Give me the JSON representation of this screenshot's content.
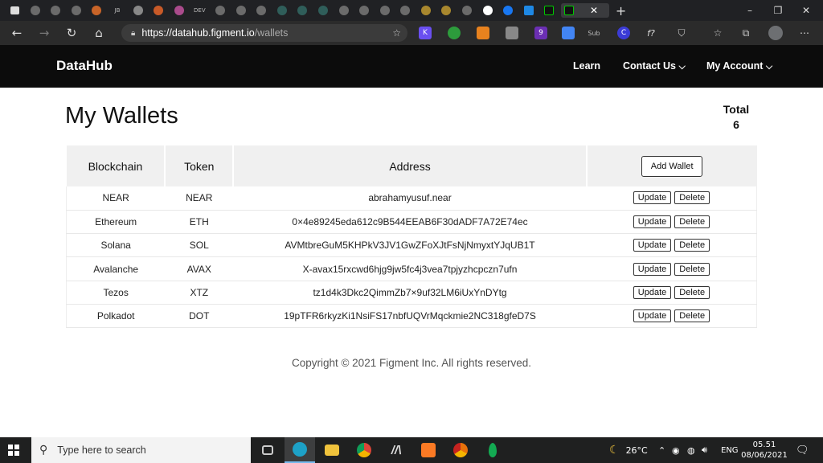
{
  "browser": {
    "url_host": "https://datahub.figment.io",
    "url_path": "/wallets",
    "tab_texts": [
      "JB",
      "DEV"
    ],
    "extensions": [
      {
        "icon": "k-extension-icon",
        "glyph": "K",
        "color": "#6a4ff0"
      },
      {
        "icon": "globe-extension-icon",
        "glyph": "",
        "color": "#2d9c3c"
      },
      {
        "icon": "metamask-icon",
        "glyph": "",
        "color": "#e8821e"
      },
      {
        "icon": "mail-extension-icon",
        "glyph": "",
        "color": "#888888"
      },
      {
        "icon": "purple-extension-icon",
        "glyph": "9",
        "color": "#6b2fb3"
      },
      {
        "icon": "translate-icon",
        "glyph": "",
        "color": "#4285f4"
      },
      {
        "icon": "sub-extension-icon",
        "glyph": "Sub",
        "color": "#2b2b2b"
      },
      {
        "icon": "c-extension-icon",
        "glyph": "C",
        "color": "#3b3bd6"
      },
      {
        "icon": "formula-extension-icon",
        "glyph": "f?",
        "color": "#2b2b2b"
      },
      {
        "icon": "shield-extension-icon",
        "glyph": "",
        "color": "#aaaaaa"
      }
    ]
  },
  "header": {
    "brand": "DataHub",
    "nav": [
      {
        "label": "Learn"
      },
      {
        "label": "Contact Us",
        "chevron": "⌄"
      },
      {
        "label": "My Account",
        "chevron": "⌄"
      }
    ]
  },
  "page": {
    "title": "My Wallets",
    "total_label": "Total",
    "total_value": "6",
    "columns": [
      "Blockchain",
      "Token",
      "Address"
    ],
    "add_wallet": "Add Wallet",
    "update_label": "Update",
    "delete_label": "Delete",
    "rows": [
      {
        "blockchain": "NEAR",
        "token": "NEAR",
        "address": "abrahamyusuf.near"
      },
      {
        "blockchain": "Ethereum",
        "token": "ETH",
        "address": "0×4e89245eda612c9B544EEAB6F30dADF7A72E74ec"
      },
      {
        "blockchain": "Solana",
        "token": "SOL",
        "address": "AVMtbreGuM5KHPkV3JV1GwZFoXJtFsNjNmyxtYJqUB1T"
      },
      {
        "blockchain": "Avalanche",
        "token": "AVAX",
        "address": "X-avax15rxcwd6hjg9jw5fc4j3vea7tpjyzhcpczn7ufn"
      },
      {
        "blockchain": "Tezos",
        "token": "XTZ",
        "address": "tz1d4k3Dkc2QimmZb7×9uf32LM6iUxYnDYtg"
      },
      {
        "blockchain": "Polkadot",
        "token": "DOT",
        "address": "19pTFR6rkyzKi1NsiFS17nbfUQVrMqckmie2NC318gfeD7S"
      }
    ],
    "copyright": "Copyright © 2021 Figment Inc. All rights reserved."
  },
  "taskbar": {
    "search_placeholder": "Type here to search",
    "weather": "26°C",
    "language": "ENG",
    "time": "05.51",
    "date": "08/06/2021",
    "apps": [
      {
        "icon": "task-view-icon",
        "color": "#444444"
      },
      {
        "icon": "edge-icon",
        "color": "#1da1c7"
      },
      {
        "icon": "file-explorer-icon",
        "color": "#f0c33c"
      },
      {
        "icon": "chrome-icon",
        "color": "#db4437"
      },
      {
        "icon": "ia-app-icon",
        "color": "#dddddd"
      },
      {
        "icon": "xampp-icon",
        "color": "#fb7a24"
      },
      {
        "icon": "chrome-canary-icon",
        "color": "#f4b400"
      },
      {
        "icon": "mongodb-compass-icon",
        "color": "#13aa52"
      }
    ]
  }
}
